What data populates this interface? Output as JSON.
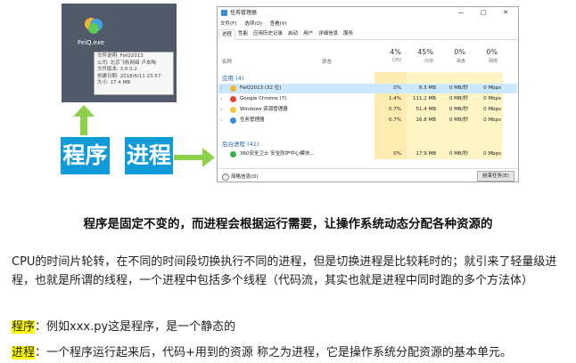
{
  "exe": {
    "name": "FeiQ.exe",
    "tooltip": [
      "文件说明: FeiQ2013",
      "公司: 北京飞秋网络 卢本陶",
      "文件版本: 3.0.0.2",
      "创建日期: 2018/6/11 23:57",
      "大小: 17.4 MB"
    ]
  },
  "labels": {
    "program": "程序",
    "process": "进程"
  },
  "taskmgr": {
    "title": "任务管理器",
    "win_buttons": [
      "—",
      "□",
      "✕"
    ],
    "menu": [
      "文件(F)",
      "选项(O)",
      "查看(V)"
    ],
    "tabs": [
      "进程",
      "性能",
      "应用历史记录",
      "启动",
      "用户",
      "详细信息",
      "服务"
    ],
    "headers": {
      "name": "名称",
      "status": "状态"
    },
    "columns": [
      {
        "pct": "4%",
        "label": "CPU"
      },
      {
        "pct": "45%",
        "label": "内存"
      },
      {
        "pct": "0%",
        "label": "磁盘"
      },
      {
        "pct": "0%",
        "label": "网络"
      }
    ],
    "group_apps": "应用 (4)",
    "group_bg": "后台进程 (41)",
    "rows": [
      {
        "name": "FeiQ2013 (32 位)",
        "cpu": "0%",
        "mem": "8.5 MB",
        "disk": "0 MB/秒",
        "net": "0 Mbps",
        "icon": "#f2b233",
        "selected": true
      },
      {
        "name": "Google Chrome (7)",
        "cpu": "1.4%",
        "mem": "111.2 MB",
        "disk": "0 MB/秒",
        "net": "0 Mbps",
        "icon": "#e94235",
        "selected": false
      },
      {
        "name": "Windows 资源管理器",
        "cpu": "0.7%",
        "mem": "51.4 MB",
        "disk": "0 MB/秒",
        "net": "0 Mbps",
        "icon": "#f4c542",
        "selected": false
      },
      {
        "name": "任务管理器",
        "cpu": "0.7%",
        "mem": "16.8 MB",
        "disk": "0 MB/秒",
        "net": "0 Mbps",
        "icon": "#3a8fd6",
        "selected": false
      },
      {
        "name": "360安全卫士 安全防护中心模块...",
        "cpu": "0%",
        "mem": "17.9 MB",
        "disk": "0 MB/秒",
        "net": "0 Mbps",
        "icon": "#36b24a",
        "selected": false
      }
    ],
    "footer_less": "简略信息(D)",
    "footer_button": "结束任务(E)"
  },
  "text": {
    "heading": "程序是固定不变的，而进程会根据运行需要，让操作系统动态分配各种资源的",
    "para": "CPU的时间片轮转，在不同的时间段切换执行不同的进程，但是切换进程是比较耗时的；就引来了轻量级进程，也就是所谓的线程，一个进程中包括多个线程（代码流，其实也就是进程中同时跑的多个方法体）",
    "program_term": "程序",
    "program_desc": "：例如xxx.py这是程序，是一个静态的",
    "process_term": "进程",
    "process_desc": "：一个程序运行起来后，代码+用到的资源 称之为进程，它是操作系统分配资源的基本单元。"
  }
}
